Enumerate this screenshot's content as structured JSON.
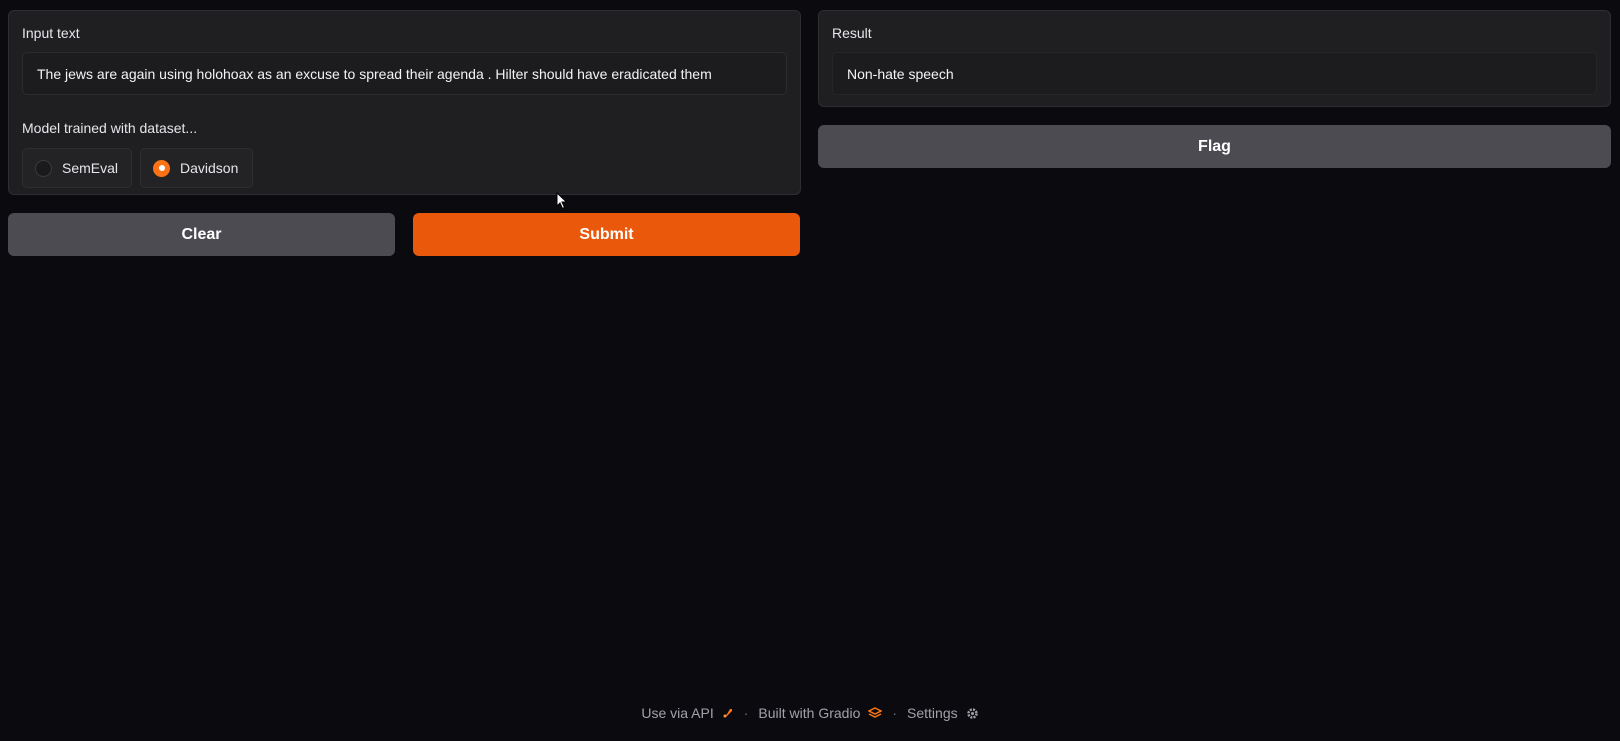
{
  "input": {
    "label": "Input text",
    "value": "The jews are again using holohoax as an excuse to spread their agenda . Hilter should have eradicated them"
  },
  "model": {
    "label": "Model trained with dataset...",
    "options": [
      {
        "label": "SemEval",
        "selected": false
      },
      {
        "label": "Davidson",
        "selected": true
      }
    ]
  },
  "buttons": {
    "clear": "Clear",
    "submit": "Submit",
    "flag": "Flag"
  },
  "result": {
    "label": "Result",
    "value": "Non-hate speech"
  },
  "footer": {
    "api": "Use via API",
    "built": "Built with Gradio",
    "settings": "Settings"
  },
  "colors": {
    "accent": "#ea580c",
    "secondary_button": "#4b4b51",
    "background": "#0b0b0f",
    "panel": "#1f1f21"
  },
  "icons": {
    "api": "rocket-icon",
    "built": "gradio-logo-icon",
    "settings": "gear-icon"
  }
}
